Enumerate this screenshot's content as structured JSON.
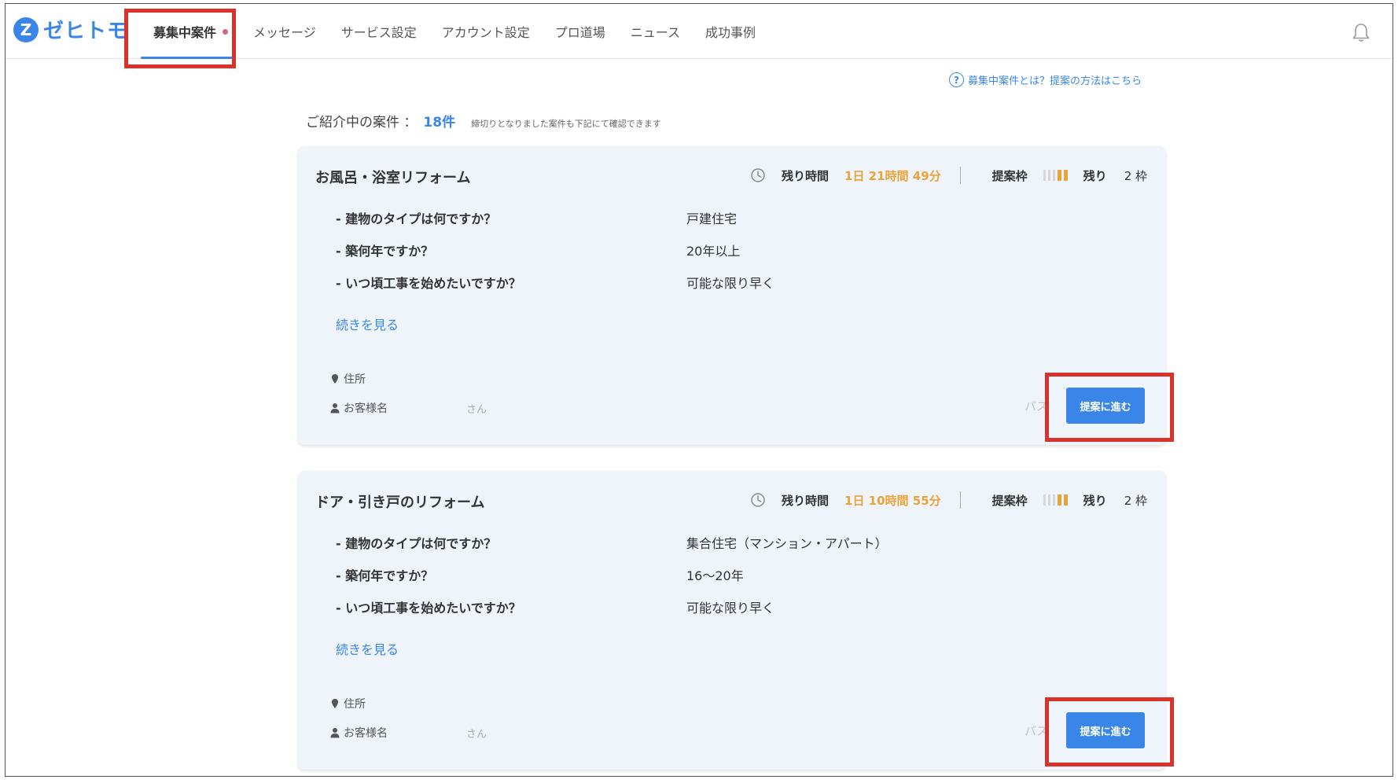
{
  "app": {
    "logo_mark": "Z",
    "logo_text": "ゼヒトモ"
  },
  "nav": {
    "items": [
      {
        "label": "募集中案件",
        "active": true,
        "badge": true
      },
      {
        "label": "メッセージ",
        "active": false
      },
      {
        "label": "サービス設定",
        "active": false
      },
      {
        "label": "アカウント設定",
        "active": false
      },
      {
        "label": "プロ道場",
        "active": false
      },
      {
        "label": "ニュース",
        "active": false
      },
      {
        "label": "成功事例",
        "active": false
      }
    ]
  },
  "help": {
    "icon": "question-circle-icon",
    "text": "募集中案件とは？提案の方法はこちら"
  },
  "summary": {
    "label": "ご紹介中の案件 ：",
    "count": "18件",
    "note": "締切りとなりました案件も下記にて確認できます"
  },
  "cards": [
    {
      "title": "お風呂・浴室リフォーム",
      "time_label": "残り時間",
      "time_remaining": "1日 21時間 49分",
      "slots_label": "提案枠",
      "remaining_label": "残り",
      "remaining_value": "2 枠",
      "questions": [
        {
          "q": "- 建物のタイプは何ですか？",
          "a": "戸建住宅"
        },
        {
          "q": "- 築何年ですか？",
          "a": "20年以上"
        },
        {
          "q": "- いつ頃工事を始めたいですか？",
          "a": "可能な限り早く"
        }
      ],
      "more_label": "続きを見る",
      "address_label": "住所",
      "customer_label": "お客様名",
      "customer_suffix": "さん",
      "pass_label": "パス",
      "button_label": "提案に進む"
    },
    {
      "title": "ドア・引き戸のリフォーム",
      "time_label": "残り時間",
      "time_remaining": "1日 10時間 55分",
      "slots_label": "提案枠",
      "remaining_label": "残り",
      "remaining_value": "2 枠",
      "questions": [
        {
          "q": "- 建物のタイプは何ですか？",
          "a": "集合住宅（マンション・アパート）"
        },
        {
          "q": "- 築何年ですか？",
          "a": "16〜20年"
        },
        {
          "q": "- いつ頃工事を始めたいですか？",
          "a": "可能な限り早く"
        }
      ],
      "more_label": "続きを見る",
      "address_label": "住所",
      "customer_label": "お客様名",
      "customer_suffix": "さん",
      "pass_label": "パス",
      "button_label": "提案に進む"
    }
  ],
  "colors": {
    "accent": "#3a86e8",
    "timer": "#e8a33a",
    "highlight": "#d9322a",
    "card_bg": "#eef4fa"
  }
}
